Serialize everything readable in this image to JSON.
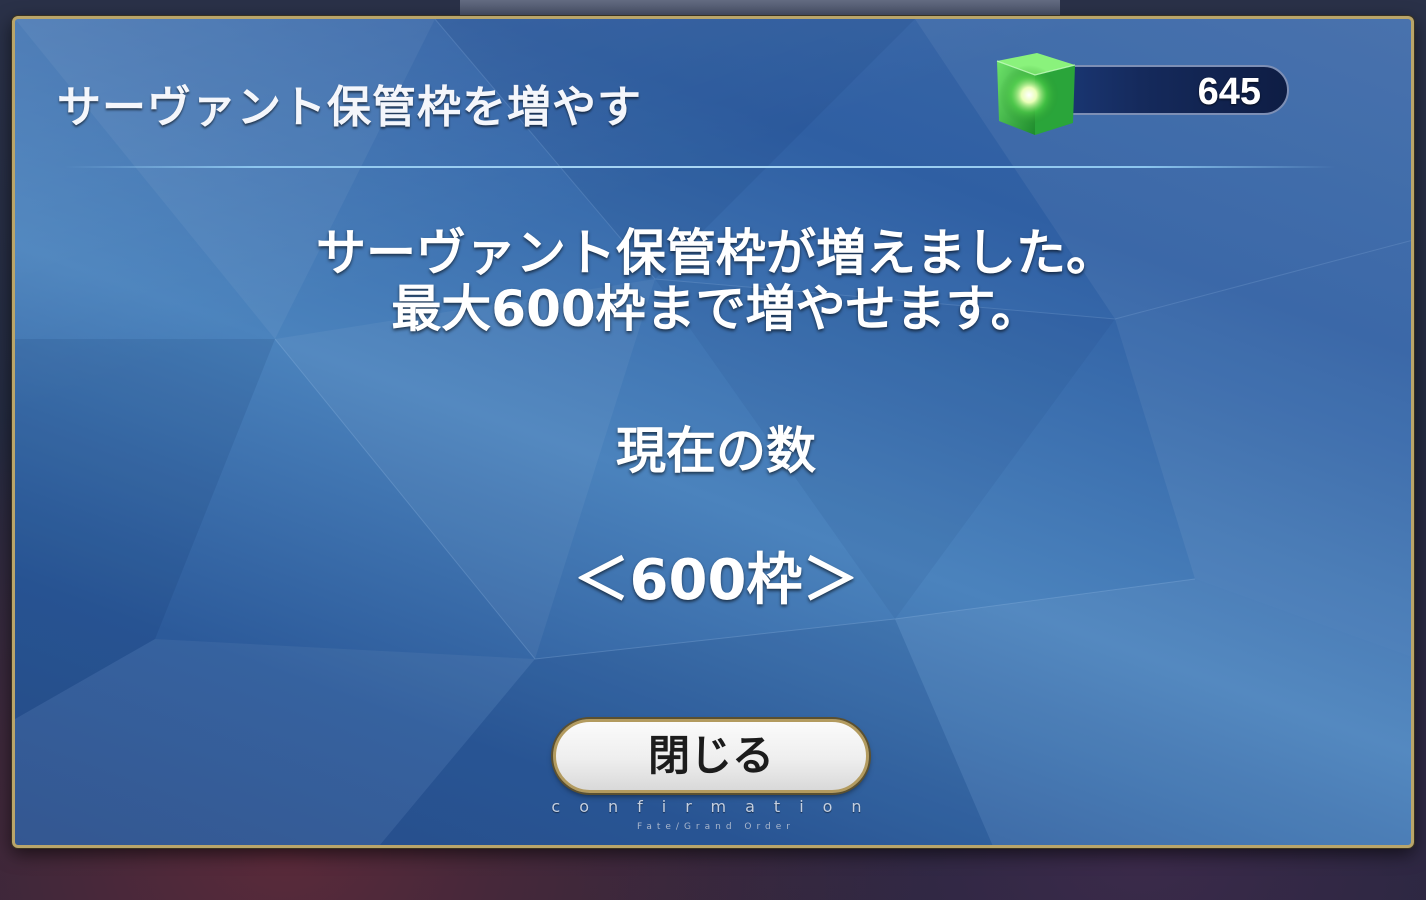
{
  "dialog": {
    "title": "サーヴァント保管枠を増やす",
    "message_lines": [
      "サーヴァント保管枠が増えました。",
      "最大600枠まで増やせます。"
    ],
    "current_count_label": "現在の数",
    "current_count_value": "＜600枠＞",
    "close_button_label": "閉じる",
    "confirmation_text": "confirmation",
    "brand_text": "Fate/Grand Order"
  },
  "currency": {
    "icon": "saint-quartz-icon",
    "amount": "645"
  },
  "colors": {
    "panel_blue": "#3e6aa8",
    "border_gold": "#b9a56a",
    "divider": "#8cc6ef",
    "quartz_green": "#4bd84a"
  }
}
